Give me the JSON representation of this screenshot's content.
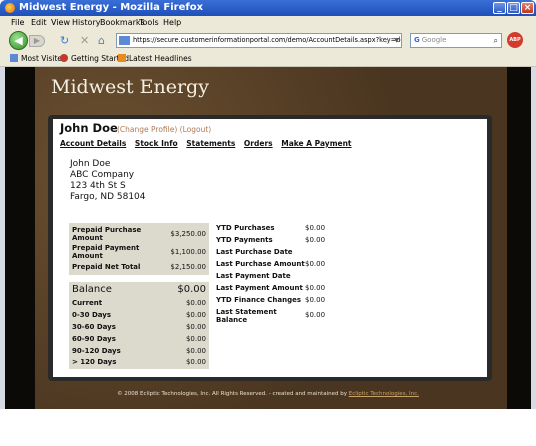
{
  "browser": {
    "window_title": "Midwest Energy - Mozilla Firefox",
    "menu": [
      "File",
      "Edit",
      "View",
      "History",
      "Bookmarks",
      "Tools",
      "Help"
    ],
    "url": "https://secure.customerinformationportal.com/demo/AccountDetails.aspx?key=demo",
    "search_placeholder": "Google",
    "bookmarks": [
      "Most Visited",
      "Getting Started",
      "Latest Headlines"
    ]
  },
  "site": {
    "title": "Midwest Energy",
    "footer_text": "© 2008 Ecliptic Technologies, Inc. All Rights Reserved. - created and maintained by",
    "footer_link": "Ecliptic Technologies, Inc."
  },
  "account": {
    "name": "John Doe",
    "change_profile": "(Change Profile)",
    "logout": "(Logout)",
    "tabs": [
      "Account Details",
      "Stock Info",
      "Statements",
      "Orders",
      "Make A Payment"
    ],
    "address": [
      "John Doe",
      "ABC Company",
      "123 4th St S",
      "Fargo, ND 58104"
    ]
  },
  "prepaid": [
    {
      "label": "Prepaid Purchase Amount",
      "value": "$3,250.00"
    },
    {
      "label": "Prepaid Payment Amount",
      "value": "$1,100.00"
    },
    {
      "label": "Prepaid Net Total",
      "value": "$2,150.00"
    }
  ],
  "balance": {
    "label": "Balance",
    "value": "$0.00",
    "rows": [
      {
        "label": "Current",
        "value": "$0.00"
      },
      {
        "label": "0-30 Days",
        "value": "$0.00"
      },
      {
        "label": "30-60 Days",
        "value": "$0.00"
      },
      {
        "label": "60-90 Days",
        "value": "$0.00"
      },
      {
        "label": "90-120 Days",
        "value": "$0.00"
      },
      {
        "label": "> 120 Days",
        "value": "$0.00"
      }
    ]
  },
  "ytd": [
    {
      "label": "YTD Purchases",
      "value": "$0.00"
    },
    {
      "label": "YTD Payments",
      "value": "$0.00"
    },
    {
      "label": "Last Purchase Date",
      "value": ""
    },
    {
      "label": "Last Purchase Amount",
      "value": "$0.00"
    },
    {
      "label": "Last Payment Date",
      "value": ""
    },
    {
      "label": "Last Payment Amount",
      "value": "$0.00"
    },
    {
      "label": "YTD Finance Changes",
      "value": "$0.00"
    },
    {
      "label": "Last Statement Balance",
      "value": "$0.00"
    }
  ]
}
